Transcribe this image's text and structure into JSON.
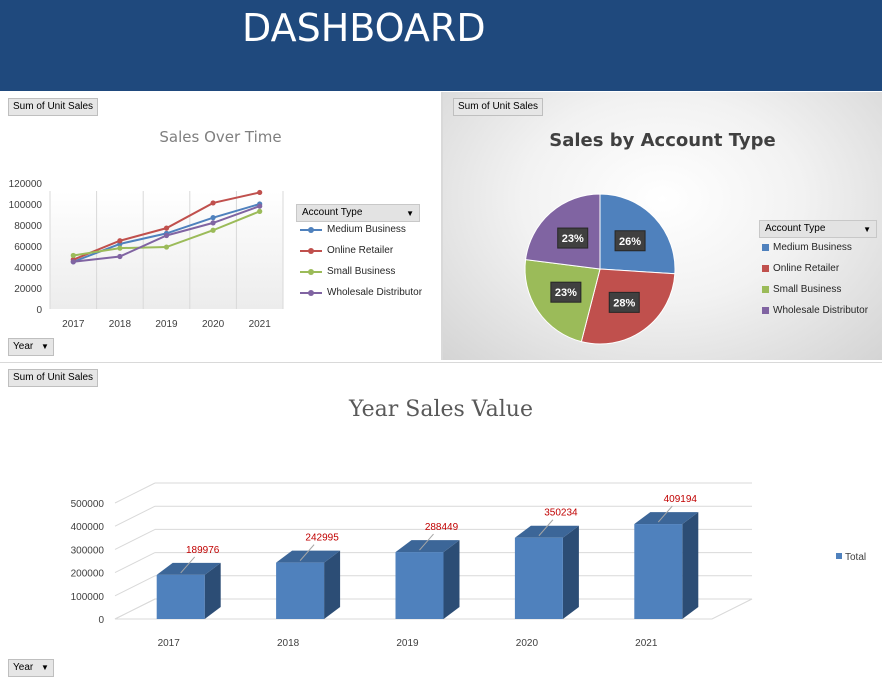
{
  "header": {
    "title": "DASHBOARD"
  },
  "line_panel": {
    "field_button": "Sum of Unit Sales",
    "filter_button": "Year",
    "legend_header": "Account Type"
  },
  "pie_panel": {
    "field_button": "Sum of Unit Sales",
    "legend_header": "Account Type"
  },
  "bar_panel": {
    "field_button": "Sum of Unit Sales",
    "filter_button": "Year"
  },
  "colors": {
    "header_bg": "#1f497d",
    "medium_business": "#4f81bd",
    "online_retailer": "#c0504d",
    "small_business": "#9bbb59",
    "wholesale_distributor": "#8064a2",
    "bar_front": "#4f81bd",
    "bar_side": "#2c4d75",
    "bar_top": "#3c6698",
    "data_label": "#c00000"
  },
  "chart_data": [
    {
      "type": "line",
      "title": "Sales Over Time",
      "categories": [
        "2017",
        "2018",
        "2019",
        "2020",
        "2021"
      ],
      "ylim": [
        0,
        120000
      ],
      "yticks": [
        "0",
        "20000",
        "40000",
        "60000",
        "80000",
        "100000",
        "120000"
      ],
      "grid": "vertical",
      "legend_position": "right",
      "series": [
        {
          "name": "Medium Business",
          "values": [
            45000,
            62000,
            72000,
            87000,
            100000
          ]
        },
        {
          "name": "Online Retailer",
          "values": [
            47000,
            65000,
            77000,
            101000,
            111000
          ]
        },
        {
          "name": "Small Business",
          "values": [
            51000,
            58000,
            59000,
            75000,
            93000
          ]
        },
        {
          "name": "Wholesale Distributor",
          "values": [
            45000,
            50000,
            70000,
            82000,
            98000
          ]
        }
      ]
    },
    {
      "type": "pie",
      "title": "Sales by Account Type",
      "legend_position": "right",
      "labels": [
        "Medium Business",
        "Online Retailer",
        "Small Business",
        "Wholesale Distributor"
      ],
      "values": [
        26,
        28,
        23,
        23
      ],
      "value_labels": [
        "26%",
        "28%",
        "23%",
        "23%"
      ]
    },
    {
      "type": "bar",
      "title": "Year Sales Value",
      "categories": [
        "2017",
        "2018",
        "2019",
        "2020",
        "2021"
      ],
      "ylim": [
        0,
        500000
      ],
      "yticks": [
        "0",
        "100000",
        "200000",
        "300000",
        "400000",
        "500000"
      ],
      "legend_position": "right",
      "series": [
        {
          "name": "Total",
          "values": [
            189976,
            242995,
            288449,
            350234,
            409194
          ]
        }
      ],
      "value_labels": [
        "189976",
        "242995",
        "288449",
        "350234",
        "409194"
      ]
    }
  ]
}
